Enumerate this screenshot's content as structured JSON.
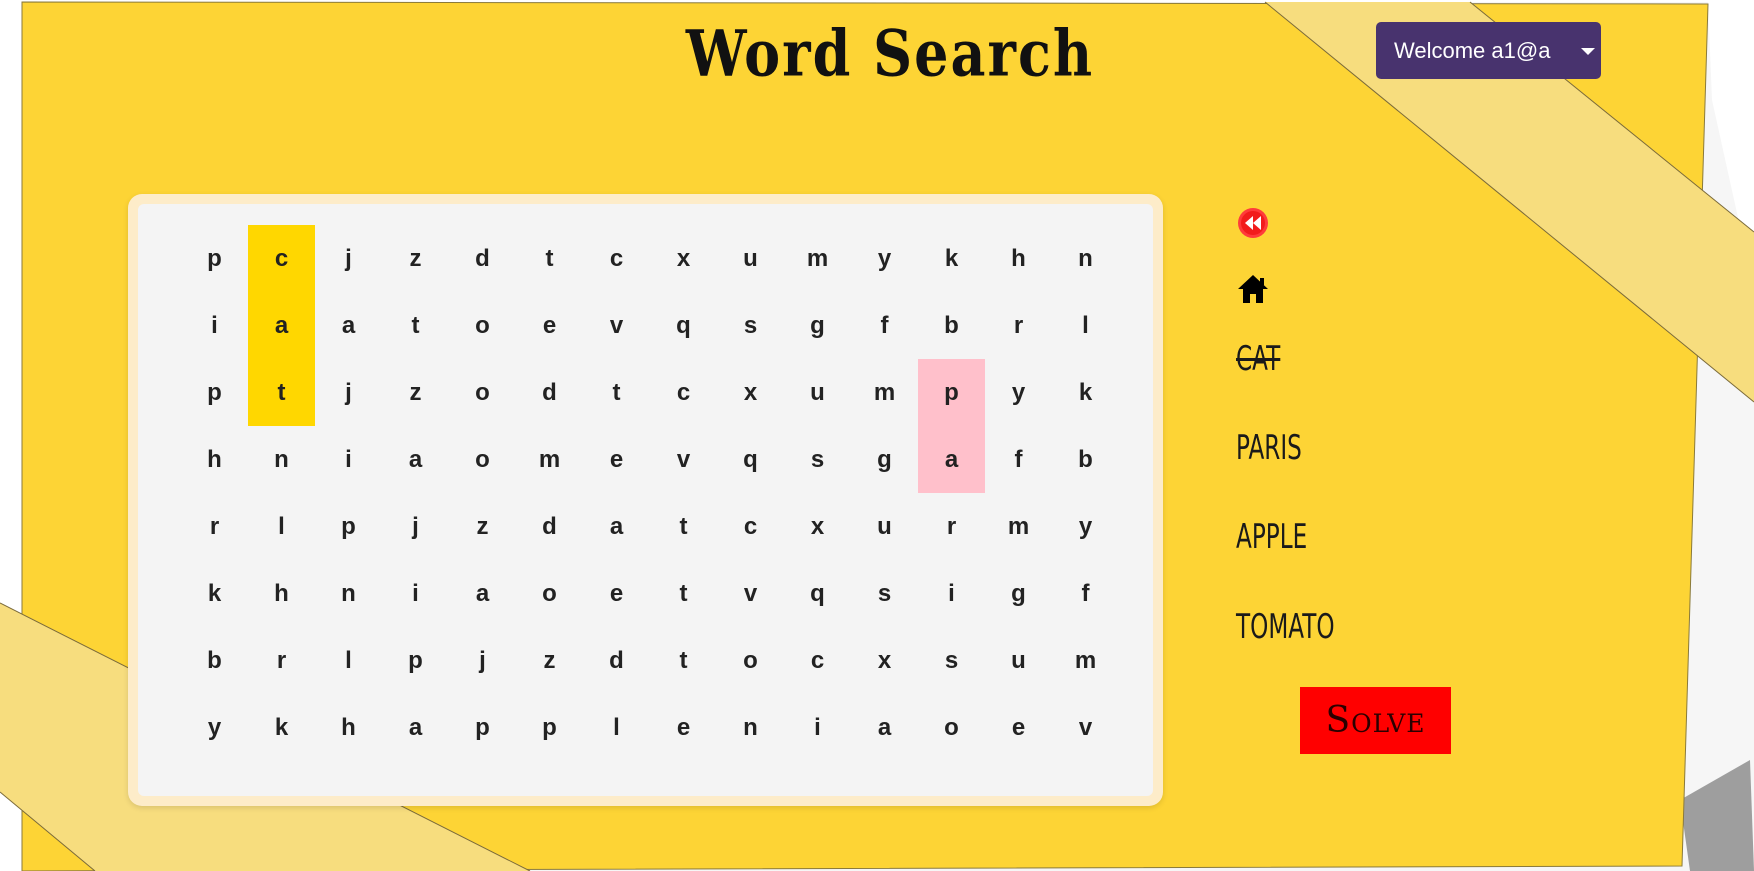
{
  "app": {
    "title": "Word Search",
    "background_color": "#fdd435",
    "accent_stripe_color": "#f7dd7e"
  },
  "header": {
    "user_menu_label": "Welcome a1@a",
    "user_menu_color": "#48336e"
  },
  "nav": {
    "back_icon": "rewind-icon",
    "home_icon": "home-icon"
  },
  "grid": {
    "rows": [
      [
        "p",
        "c",
        "j",
        "z",
        "d",
        "t",
        "c",
        "x",
        "u",
        "m",
        "y",
        "k",
        "h",
        "n"
      ],
      [
        "i",
        "a",
        "a",
        "t",
        "o",
        "e",
        "v",
        "q",
        "s",
        "g",
        "f",
        "b",
        "r",
        "l"
      ],
      [
        "p",
        "t",
        "j",
        "z",
        "o",
        "d",
        "t",
        "c",
        "x",
        "u",
        "m",
        "p",
        "y",
        "k"
      ],
      [
        "h",
        "n",
        "i",
        "a",
        "o",
        "m",
        "e",
        "v",
        "q",
        "s",
        "g",
        "a",
        "f",
        "b"
      ],
      [
        "r",
        "l",
        "p",
        "j",
        "z",
        "d",
        "a",
        "t",
        "c",
        "x",
        "u",
        "r",
        "m",
        "y"
      ],
      [
        "k",
        "h",
        "n",
        "i",
        "a",
        "o",
        "e",
        "t",
        "v",
        "q",
        "s",
        "i",
        "g",
        "f"
      ],
      [
        "b",
        "r",
        "l",
        "p",
        "j",
        "z",
        "d",
        "t",
        "o",
        "c",
        "x",
        "s",
        "u",
        "m"
      ],
      [
        "y",
        "k",
        "h",
        "a",
        "p",
        "p",
        "l",
        "e",
        "n",
        "i",
        "a",
        "o",
        "e",
        "v"
      ]
    ],
    "found_cells": [
      [
        0,
        1
      ],
      [
        1,
        1
      ],
      [
        2,
        1
      ]
    ],
    "selected_cells": [
      [
        2,
        11
      ],
      [
        3,
        11
      ]
    ],
    "found_color": "#ffd700",
    "selected_color": "#ffc0cb"
  },
  "words": [
    {
      "label": "CAT",
      "found": true
    },
    {
      "label": "PARIS",
      "found": false
    },
    {
      "label": "APPLE",
      "found": false
    },
    {
      "label": "TOMATO",
      "found": false
    }
  ],
  "actions": {
    "solve_label": "Solve",
    "solve_color": "#ff0000"
  }
}
